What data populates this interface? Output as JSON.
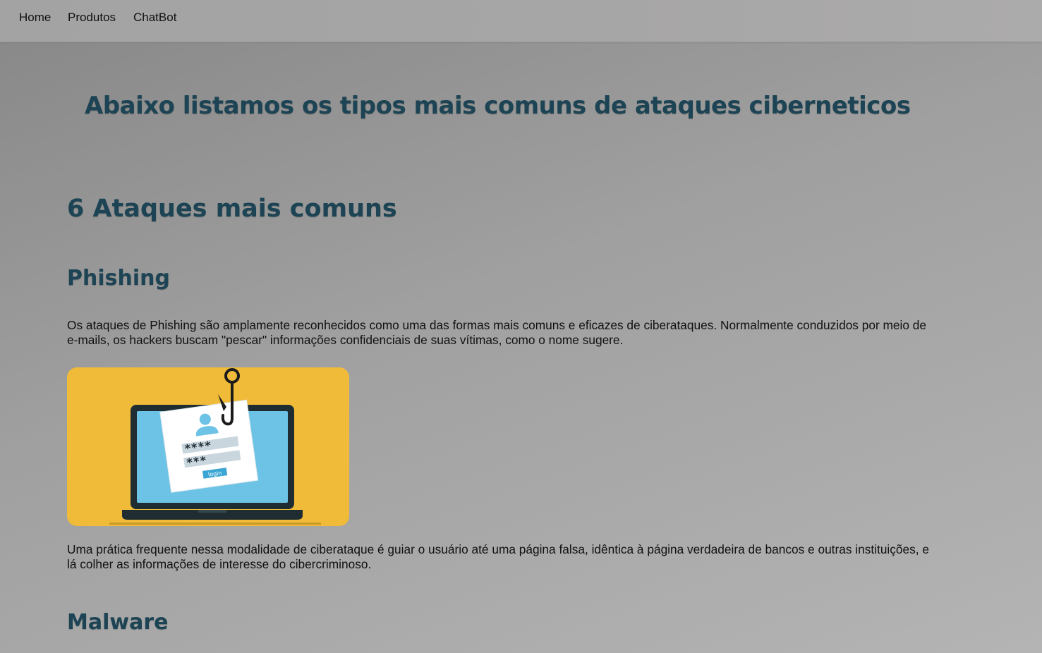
{
  "nav": {
    "items": [
      "Home",
      "Produtos",
      "ChatBot"
    ]
  },
  "banner": {
    "title": "Abaixo listamos os tipos mais comuns de ataques ciberneticos"
  },
  "main": {
    "section_title": "6 Ataques mais comuns",
    "attacks": [
      {
        "heading": "Phishing",
        "paragraph_1": "Os ataques de Phishing são amplamente reconhecidos como uma das formas mais comuns e eficazes de ciberataques. Normalmente conduzidos por meio de e-mails, os hackers buscam \"pescar\" informações confidenciais de suas vítimas, como o nome sugere.",
        "illustration": {
          "password_1": "****",
          "password_2": "***",
          "button_label": "login"
        },
        "paragraph_2": "Uma prática frequente nessa modalidade de ciberataque é guiar o usuário até uma página falsa, idêntica à página verdadeira de bancos e outras instituições, e lá colher as informações de interesse do cibercriminoso."
      },
      {
        "heading": "Malware"
      }
    ]
  },
  "colors": {
    "heading": "#1d4454",
    "illustration_bg": "#f0bb38",
    "screen": "#6cc3e6",
    "laptop": "#1f2d33"
  }
}
